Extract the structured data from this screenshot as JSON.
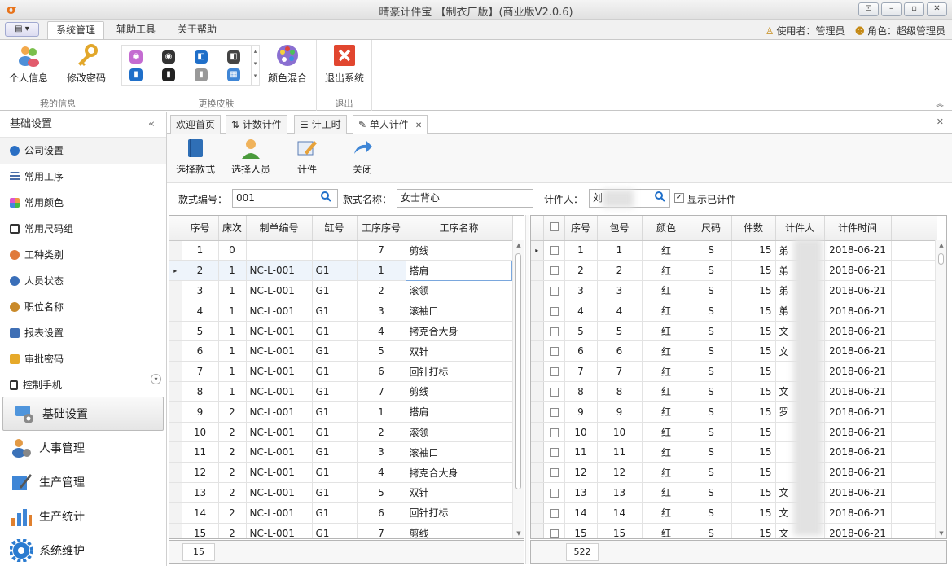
{
  "window": {
    "title": "晴豪计件宝 【制衣厂版】(商业版V2.0.6)",
    "logo": "σ"
  },
  "menu": {
    "tabs": [
      "系统管理",
      "辅助工具",
      "关于帮助"
    ],
    "user_label": "使用者：管理员",
    "role_label": "角色：超级管理员"
  },
  "ribbon": {
    "groups": [
      {
        "label": "我的信息",
        "buttons": [
          "个人信息",
          "修改密码"
        ]
      },
      {
        "label": "更换皮肤",
        "buttons": [
          "颜色混合"
        ]
      },
      {
        "label": "退出",
        "buttons": [
          "退出系统"
        ]
      }
    ]
  },
  "sidebar": {
    "header": "基础设置",
    "items": [
      "公司设置",
      "常用工序",
      "常用颜色",
      "常用尺码组",
      "工种类别",
      "人员状态",
      "职位名称",
      "报表设置",
      "审批密码",
      "控制手机"
    ],
    "nav": [
      "基础设置",
      "人事管理",
      "生产管理",
      "生产统计",
      "系统维护"
    ]
  },
  "doctabs": [
    "欢迎首页",
    "计数计件",
    "计工时",
    "单人计件"
  ],
  "toolbar": [
    "选择款式",
    "选择人员",
    "计件",
    "关闭"
  ],
  "filter": {
    "style_no_label": "款式编号：",
    "style_no_value": "001",
    "style_name_label": "款式名称：",
    "style_name_value": "女士背心",
    "worker_label": "计件人：",
    "worker_value": "刘",
    "show_done_label": "显示已计件"
  },
  "left_grid": {
    "headers": [
      "序号",
      "床次",
      "制单编号",
      "缸号",
      "工序序号",
      "工序名称"
    ],
    "rows": [
      [
        "1",
        "0",
        "",
        "",
        "7",
        "剪线"
      ],
      [
        "2",
        "1",
        "NC-L-001",
        "G1",
        "1",
        "搭肩"
      ],
      [
        "3",
        "1",
        "NC-L-001",
        "G1",
        "2",
        "滚领"
      ],
      [
        "4",
        "1",
        "NC-L-001",
        "G1",
        "3",
        "滚袖口"
      ],
      [
        "5",
        "1",
        "NC-L-001",
        "G1",
        "4",
        "拷克合大身"
      ],
      [
        "6",
        "1",
        "NC-L-001",
        "G1",
        "5",
        "双针"
      ],
      [
        "7",
        "1",
        "NC-L-001",
        "G1",
        "6",
        "回针打标"
      ],
      [
        "8",
        "1",
        "NC-L-001",
        "G1",
        "7",
        "剪线"
      ],
      [
        "9",
        "2",
        "NC-L-001",
        "G1",
        "1",
        "搭肩"
      ],
      [
        "10",
        "2",
        "NC-L-001",
        "G1",
        "2",
        "滚领"
      ],
      [
        "11",
        "2",
        "NC-L-001",
        "G1",
        "3",
        "滚袖口"
      ],
      [
        "12",
        "2",
        "NC-L-001",
        "G1",
        "4",
        "拷克合大身"
      ],
      [
        "13",
        "2",
        "NC-L-001",
        "G1",
        "5",
        "双针"
      ],
      [
        "14",
        "2",
        "NC-L-001",
        "G1",
        "6",
        "回针打标"
      ],
      [
        "15",
        "2",
        "NC-L-001",
        "G1",
        "7",
        "剪线"
      ]
    ],
    "count": "15"
  },
  "right_grid": {
    "headers": [
      "序号",
      "包号",
      "颜色",
      "尺码",
      "件数",
      "计件人",
      "计件时间"
    ],
    "rows": [
      [
        "1",
        "1",
        "红",
        "S",
        "15",
        "弟",
        "2018-06-21"
      ],
      [
        "2",
        "2",
        "红",
        "S",
        "15",
        "弟",
        "2018-06-21"
      ],
      [
        "3",
        "3",
        "红",
        "S",
        "15",
        "弟",
        "2018-06-21"
      ],
      [
        "4",
        "4",
        "红",
        "S",
        "15",
        "弟",
        "2018-06-21"
      ],
      [
        "5",
        "5",
        "红",
        "S",
        "15",
        "文",
        "2018-06-21"
      ],
      [
        "6",
        "6",
        "红",
        "S",
        "15",
        "文",
        "2018-06-21"
      ],
      [
        "7",
        "7",
        "红",
        "S",
        "15",
        "",
        "2018-06-21"
      ],
      [
        "8",
        "8",
        "红",
        "S",
        "15",
        "文",
        "2018-06-21"
      ],
      [
        "9",
        "9",
        "红",
        "S",
        "15",
        "罗",
        "2018-06-21"
      ],
      [
        "10",
        "10",
        "红",
        "S",
        "15",
        "",
        "2018-06-21"
      ],
      [
        "11",
        "11",
        "红",
        "S",
        "15",
        "",
        "2018-06-21"
      ],
      [
        "12",
        "12",
        "红",
        "S",
        "15",
        "",
        "2018-06-21"
      ],
      [
        "13",
        "13",
        "红",
        "S",
        "15",
        "文",
        "2018-06-21"
      ],
      [
        "14",
        "14",
        "红",
        "S",
        "15",
        "文",
        "2018-06-21"
      ],
      [
        "15",
        "15",
        "红",
        "S",
        "15",
        "文",
        "2018-06-21"
      ]
    ],
    "count": "522"
  },
  "icons": {
    "user": "user-icon",
    "key": "key-icon",
    "palette": "palette-icon",
    "exit": "exit-icon",
    "search": "search-icon"
  },
  "colors": {
    "exit_red": "#e1462f",
    "accent_blue": "#1f6fc9",
    "selection": "#eef4fb"
  }
}
